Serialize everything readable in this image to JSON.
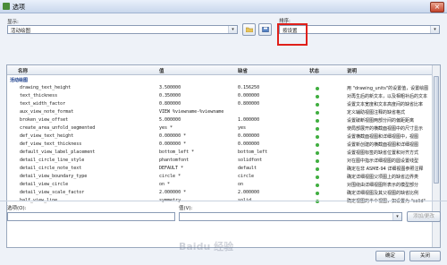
{
  "window": {
    "title": "选项",
    "close_label": "×"
  },
  "top": {
    "show_label": "显示:",
    "show_value": "活动绘图",
    "sort_label": "排序:",
    "sort_value": "按设置"
  },
  "table": {
    "headers": {
      "name": "名称",
      "value": "值",
      "default": "缺省",
      "status": "状态",
      "desc": "说明"
    },
    "section": "活动绘图",
    "rows": [
      {
        "name": "drawing_text_height",
        "value": "3.500000",
        "default": "0.156250",
        "desc": "用 \"drawing_units\"的设置值，设置绘图"
      },
      {
        "name": "text_thickness",
        "value": "0.350000",
        "default": "0.000000",
        "desc": "对再生后的新文本，以及相粗补后的文本"
      },
      {
        "name": "text_width_factor",
        "value": "0.800000",
        "default": "0.800000",
        "desc": "设置文本宽度和文本高度间的缺省比率"
      },
      {
        "name": "aux_view_note_format",
        "value": "VIEW %viewname-%viewname",
        "default": "",
        "desc": "定义辅助视图注释的缺省格式"
      },
      {
        "name": "broken_view_offset",
        "value": "5.000000",
        "default": "1.000000",
        "desc": "设置破断视图两部分间的偏距距离"
      },
      {
        "name": "create_area_unfold_segmented",
        "value": "yes *",
        "default": "yes",
        "desc": "使局部展开的横截面视图中的尺寸显示"
      },
      {
        "name": "def_view_text_height",
        "value": "0.000000 *",
        "default": "0.000000",
        "desc": "设置横截面视图和详细视图中，视图"
      },
      {
        "name": "def_view_text_thickness",
        "value": "0.000000 *",
        "default": "0.000000",
        "desc": "设置新创建的横截面视图和详细视图"
      },
      {
        "name": "default_view_label_placement",
        "value": "bottom_left *",
        "default": "bottom_left",
        "desc": "设置视图标签的缺省位置和对齐方式"
      },
      {
        "name": "detail_circle_line_style",
        "value": "phantomfont",
        "default": "solidfont",
        "desc": "对在图中指示详细视图的圆设置线型"
      },
      {
        "name": "detail_circle_note_text",
        "value": "DEFAULT *",
        "default": "default",
        "desc": "确定在非 ASME-94 详细视图参照注释"
      },
      {
        "name": "detail_view_boundary_type",
        "value": "circle *",
        "default": "circle",
        "desc": "确定详细视图父项图上的缺省边界类"
      },
      {
        "name": "detail_view_circle",
        "value": "on *",
        "default": "on",
        "desc": "对围绕由详细视图所表示的模型部分"
      },
      {
        "name": "detail_view_scale_factor",
        "value": "2.000000 *",
        "default": "2.000000",
        "desc": "确定详细视图及其父视图的缺省比例"
      },
      {
        "name": "half_view_line",
        "value": "symmetry",
        "default": "solid",
        "desc": "确定视图的半个视图，如设置为 \"solid\""
      }
    ]
  },
  "bottom": {
    "option_label": "选项(O):",
    "value_label": "值(V):",
    "add_change": "添加/更改",
    "ok": "确定",
    "close": "关闭",
    "watermark": "Baidu 经验"
  }
}
